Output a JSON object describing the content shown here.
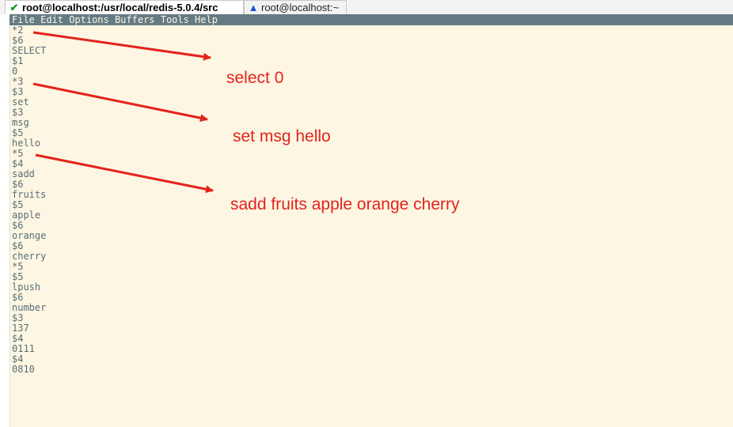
{
  "tabs": [
    {
      "label": "root@localhost:/usr/local/redis-5.0.4/src",
      "icon": "checkmark-icon",
      "active": true
    },
    {
      "label": "root@localhost:~",
      "icon": "warning-icon",
      "active": false
    }
  ],
  "menu": [
    "File",
    "Edit",
    "Options",
    "Buffers",
    "Tools",
    "Help"
  ],
  "buffer_lines": [
    "*2",
    "$6",
    "SELECT",
    "$1",
    "0",
    "*3",
    "$3",
    "set",
    "$3",
    "msg",
    "$5",
    "hello",
    "*5",
    "$4",
    "sadd",
    "$6",
    "fruits",
    "$5",
    "apple",
    "$6",
    "orange",
    "$6",
    "cherry",
    "*5",
    "$5",
    "lpush",
    "$6",
    "number",
    "$3",
    "137",
    "$4",
    "0111",
    "$4",
    "0810"
  ],
  "annotations": [
    "select 0",
    "set msg hello",
    "sadd fruits apple orange cherry"
  ],
  "colors": {
    "terminal_bg": "#fdf6e3",
    "terminal_fg": "#586e75",
    "menubar_bg": "#657b83",
    "annotation": "#e4231b"
  }
}
